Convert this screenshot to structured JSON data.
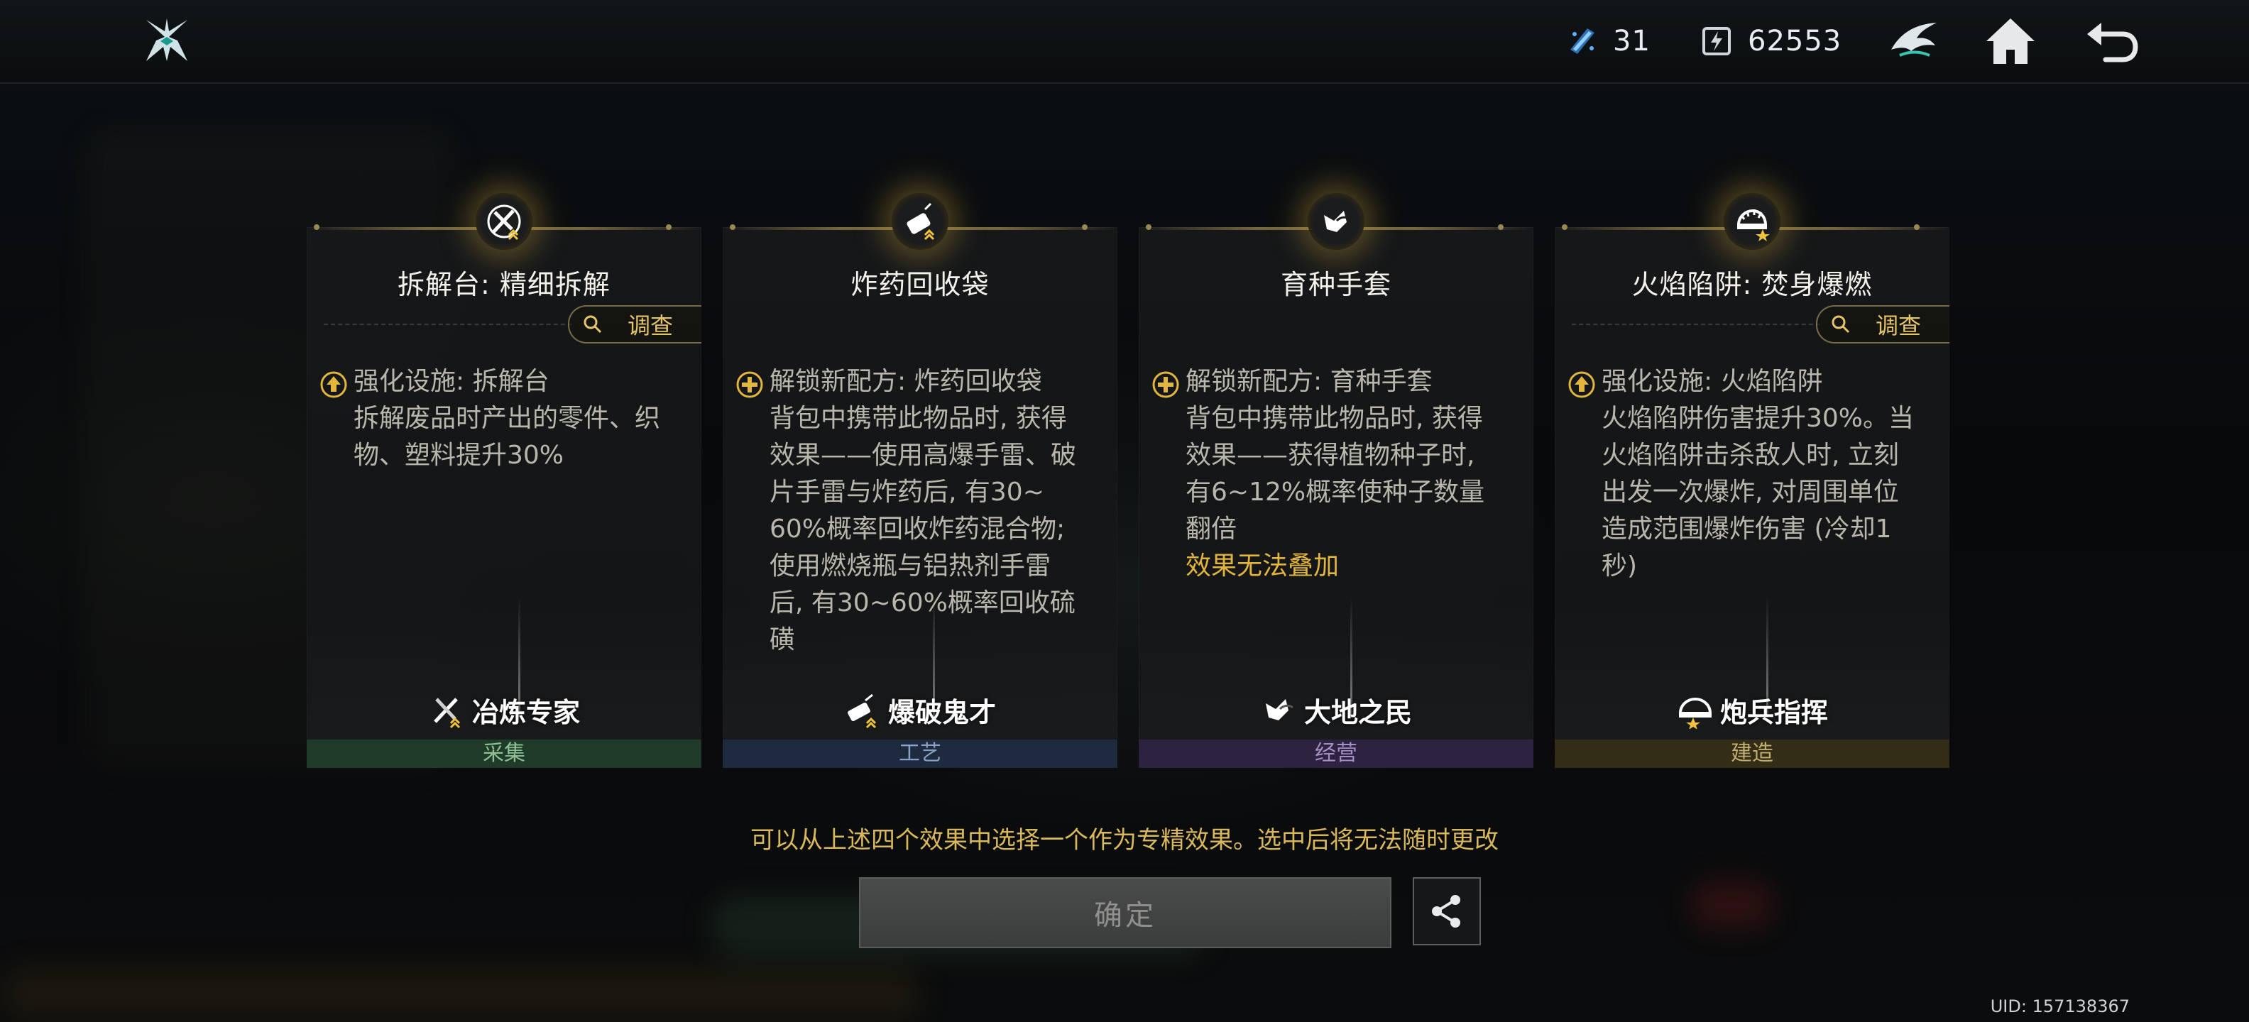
{
  "topbar": {
    "resource_1": "31",
    "resource_2": "62553"
  },
  "cards": [
    {
      "title": "拆解台: 精细拆解",
      "probe_label": "调查",
      "desc": [
        "强化设施: 拆解台",
        "拆解废品时产出的零件、织",
        "物、塑料提升30%"
      ],
      "note": "",
      "sub_title": "冶炼专家",
      "category": "采集",
      "category_color": "#1f3b2a",
      "category_text_color": "#8fbf93"
    },
    {
      "title": "炸药回收袋",
      "probe_label": "",
      "desc": [
        "解锁新配方: 炸药回收袋",
        "背包中携带此物品时, 获得",
        "效果——使用高爆手雷、破",
        "片手雷与炸药后, 有30~",
        "60%概率回收炸药混合物;",
        "使用燃烧瓶与铝热剂手雷",
        "后, 有30~60%概率回收硫",
        "磺"
      ],
      "note": "",
      "sub_title": "爆破鬼才",
      "category": "工艺",
      "category_color": "#1e2a3e",
      "category_text_color": "#8aa0c2"
    },
    {
      "title": "育种手套",
      "probe_label": "",
      "desc": [
        "解锁新配方: 育种手套",
        "背包中携带此物品时, 获得",
        "效果——获得植物种子时,",
        "有6~12%概率使种子数量",
        "翻倍"
      ],
      "note": "效果无法叠加",
      "sub_title": "大地之民",
      "category": "经营",
      "category_color": "#2d2340",
      "category_text_color": "#a391c4"
    },
    {
      "title": "火焰陷阱: 焚身爆燃",
      "probe_label": "调查",
      "desc": [
        "强化设施: 火焰陷阱",
        "火焰陷阱伤害提升30%。当",
        "火焰陷阱击杀敌人时, 立刻",
        "出发一次爆炸, 对周围单位",
        "造成范围爆炸伤害 (冷却1",
        "秒)"
      ],
      "note": "",
      "sub_title": "炮兵指挥",
      "category": "建造",
      "category_color": "#332c16",
      "category_text_color": "#c2ad72"
    }
  ],
  "hint": "可以从上述四个效果中选择一个作为专精效果。选中后将无法随时更改",
  "confirm_label": "确定",
  "uid": "UID: 157138367",
  "colors": {
    "accent_gold": "#e2b53f",
    "confirm_disabled": "#3f4040"
  }
}
